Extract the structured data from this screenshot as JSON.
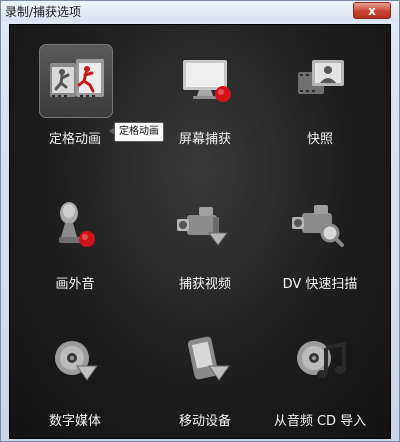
{
  "window": {
    "title": "录制/捕获选项",
    "close_label": "x"
  },
  "tooltip": {
    "text": "定格动画"
  },
  "tiles": [
    {
      "label": "定格动画",
      "icon": "stop-motion-icon",
      "selected": true
    },
    {
      "label": "屏幕捕获",
      "icon": "screen-capture-icon",
      "selected": false
    },
    {
      "label": "快照",
      "icon": "snapshot-icon",
      "selected": false
    },
    {
      "label": "画外音",
      "icon": "voiceover-mic-icon",
      "selected": false
    },
    {
      "label": "捕获视频",
      "icon": "capture-video-icon",
      "selected": false
    },
    {
      "label": "DV 快速扫描",
      "icon": "dv-quick-scan-icon",
      "selected": false
    },
    {
      "label": "数字媒体",
      "icon": "digital-media-icon",
      "selected": false
    },
    {
      "label": "移动设备",
      "icon": "mobile-device-icon",
      "selected": false
    },
    {
      "label": "从音频 CD 导入",
      "icon": "import-audio-cd-icon",
      "selected": false
    }
  ],
  "colors": {
    "panel_bg": "#1e1e1e",
    "record_red": "#d0121b",
    "label_text": "#f3f3f3"
  }
}
